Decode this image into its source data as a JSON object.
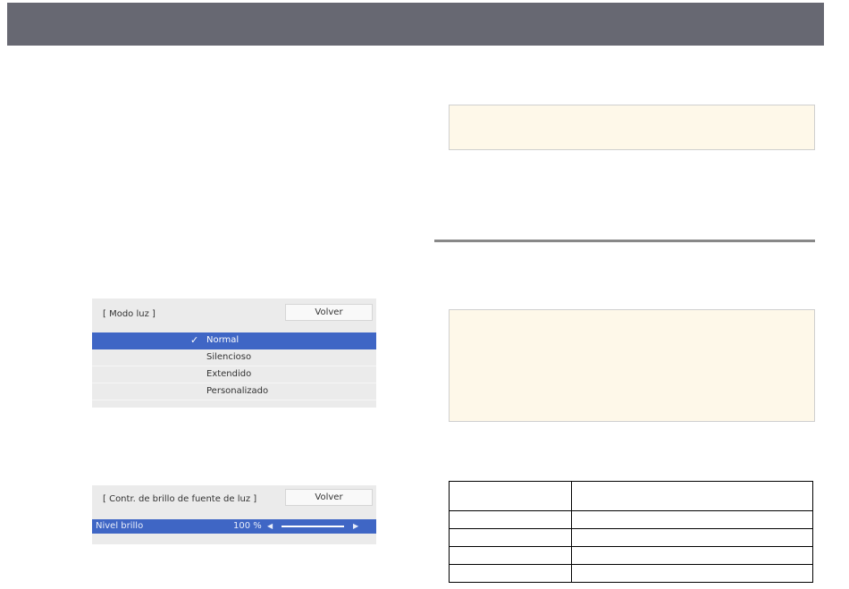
{
  "colors": {
    "header_bar": "#676872",
    "selection": "#3f66c5",
    "note_background": "#fef8e9"
  },
  "light_mode_menu": {
    "title": "[ Modo luz ]",
    "back_label": "Volver",
    "options": [
      {
        "label": "Normal",
        "selected": true
      },
      {
        "label": "Silencioso",
        "selected": false
      },
      {
        "label": "Extendido",
        "selected": false
      },
      {
        "label": "Personalizado",
        "selected": false
      }
    ]
  },
  "brightness_menu": {
    "title": "[ Contr. de brillo de fuente de luz ]",
    "back_label": "Volver",
    "slider": {
      "label": "Nivel brillo",
      "value_text": "100 %",
      "level": 1.0
    }
  },
  "table": {
    "headers": [
      "",
      ""
    ],
    "rows": [
      [
        "",
        ""
      ],
      [
        "",
        ""
      ],
      [
        "",
        ""
      ],
      [
        "",
        ""
      ]
    ]
  }
}
